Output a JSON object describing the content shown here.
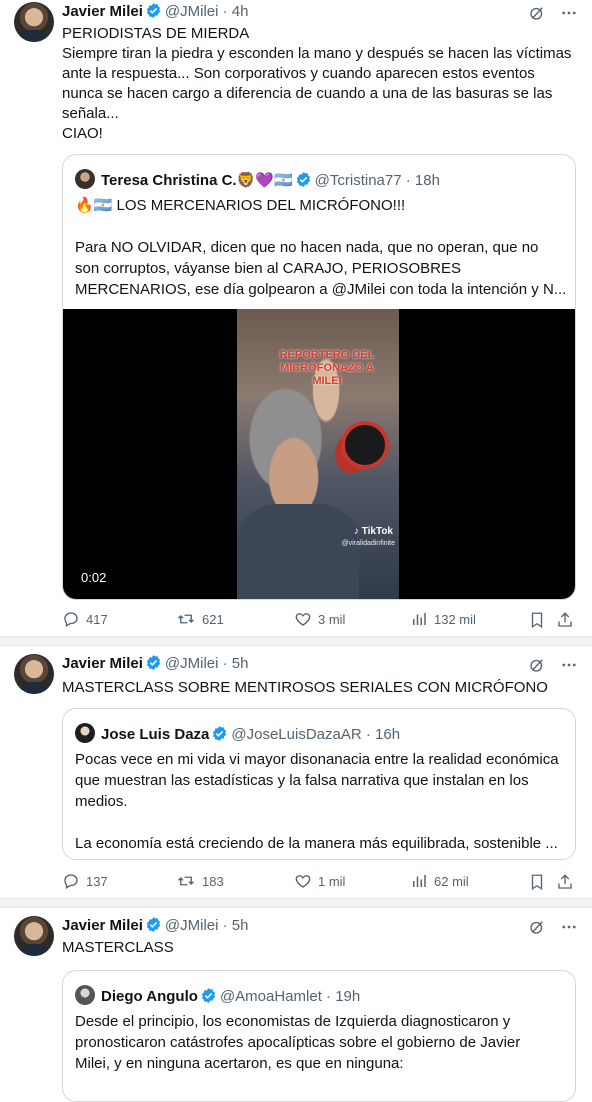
{
  "tweets": [
    {
      "author_name": "Javier Milei",
      "author_handle": "@JMilei",
      "time": "4h",
      "lines": [
        "PERIODISTAS DE MIERDA",
        "Siempre tiran la piedra y esconden la mano y después se hacen las víctimas",
        "ante la respuesta... Son corporativos y cuando aparecen estos eventos",
        "nunca se hacen cargo a diferencia de cuando a una de las basuras se las",
        "señala...",
        "CIAO!"
      ],
      "quote": {
        "author_name": "Teresa Christina C.",
        "author_emojis": "🦁💜🇦🇷",
        "author_handle": "@Tcristina77",
        "time": "18h",
        "lines": [
          "🔥🇦🇷  LOS MERCENARIOS DEL MICRÓFONO!!!",
          "",
          "Para NO OLVIDAR, dicen que no hacen nada, que no operan, que no",
          "son corruptos, váyanse bien al CARAJO, PERIOSOBRES",
          "MERCENARIOS, ese día golpearon a @JMilei con toda la intención y N..."
        ],
        "video": {
          "duration": "0:02",
          "overlay_text": "REPORTERO DEL MICRÓFONAZO A MILEI",
          "tiktok_label": "TikTok",
          "tiktok_user": "@viralidadinfinite"
        }
      },
      "stats": {
        "replies": "417",
        "reposts": "621",
        "likes": "3 mil",
        "views": "132 mil"
      }
    },
    {
      "author_name": "Javier Milei",
      "author_handle": "@JMilei",
      "time": "5h",
      "lines": [
        "MASTERCLASS SOBRE MENTIROSOS SERIALES CON MICRÓFONO"
      ],
      "quote": {
        "author_name": "Jose Luis Daza",
        "author_handle": "@JoseLuisDazaAR",
        "time": "16h",
        "lines": [
          "Pocas vece en mi vida vi mayor disonanacia entre la realidad económica",
          "que muestran las estadísticas y la falsa narrativa  que instalan en los",
          "medios.",
          "",
          "La economía está creciendo de la manera más equilibrada, sostenible ..."
        ]
      },
      "stats": {
        "replies": "137",
        "reposts": "183",
        "likes": "1 mil",
        "views": "62 mil"
      }
    },
    {
      "author_name": "Javier Milei",
      "author_handle": "@JMilei",
      "time": "5h",
      "lines": [
        "MASTERCLASS"
      ],
      "quote": {
        "author_name": "Diego Angulo",
        "author_handle": "@AmoaHamlet",
        "time": "19h",
        "lines": [
          "Desde el principio, los economistas de Izquierda diagnosticaron y",
          "pronosticaron catástrofes apocalípticas sobre el gobierno de Javier",
          "Milei, y en ninguna acertaron, es que en ninguna:"
        ]
      }
    }
  ],
  "colors": {
    "verified": "#1d9bf0",
    "secondary_text": "#536471",
    "border": "#cfd9de"
  }
}
